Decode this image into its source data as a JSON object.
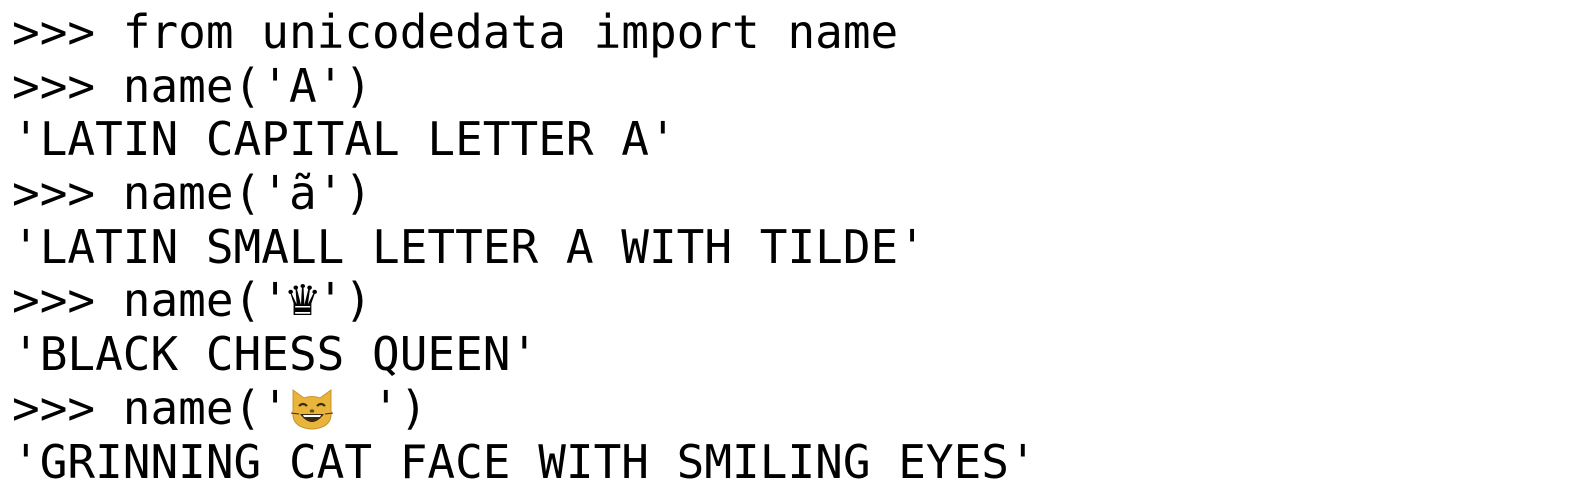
{
  "terminal": {
    "lines": [
      {
        "prompt": ">>> ",
        "text": "from unicodedata import name"
      },
      {
        "prompt": ">>> ",
        "text": "name('A')"
      },
      {
        "output": "'LATIN CAPITAL LETTER A'"
      },
      {
        "prompt": ">>> ",
        "text": "name('ã')"
      },
      {
        "output": "'LATIN SMALL LETTER A WITH TILDE'"
      },
      {
        "prompt": ">>> ",
        "text_before": "name('",
        "emoji": "♛",
        "text_after": "')"
      },
      {
        "output": "'BLACK CHESS QUEEN'"
      },
      {
        "prompt": ">>> ",
        "text_before": "name('",
        "emoji": "😸",
        "text_after": " ')"
      },
      {
        "output": "'GRINNING CAT FACE WITH SMILING EYES'"
      }
    ]
  },
  "icons": {
    "queen": "black-chess-queen-icon",
    "cat": "grinning-cat-face-icon"
  },
  "colors": {
    "text": "#000000",
    "background": "#ffffff",
    "cat": "#e8b43c"
  }
}
